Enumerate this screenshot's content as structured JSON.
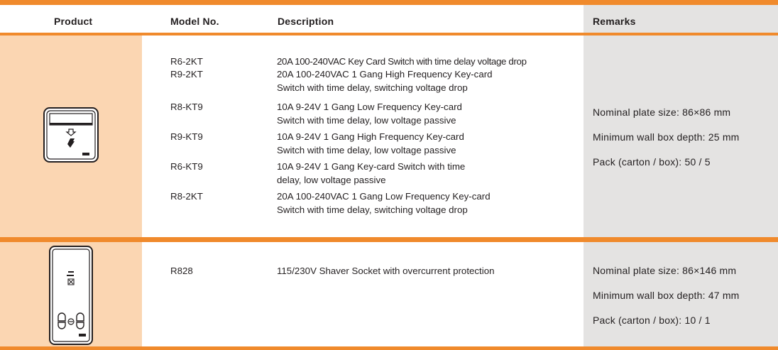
{
  "header": {
    "product": "Product",
    "model_no": "Model No.",
    "description": "Description",
    "remarks": "Remarks"
  },
  "rows": [
    {
      "product_icon": "key-card-switch-icon",
      "models": [
        {
          "model": "R6-2KT",
          "description": [
            "20A 100-240VAC Key Card Switch with time delay voltage drop"
          ]
        },
        {
          "model": "R9-2KT",
          "description": [
            "20A 100-240VAC 1 Gang High Frequency Key-card",
            "Switch with time delay, switching voltage drop"
          ]
        },
        {
          "model": "R8-KT9",
          "description": [
            "10A 9-24V 1 Gang Low Frequency Key-card",
            "Switch with time delay, low voltage passive"
          ]
        },
        {
          "model": "R9-KT9",
          "description": [
            "10A 9-24V 1 Gang High Frequency Key-card",
            "Switch with time delay, low voltage passive"
          ]
        },
        {
          "model": "R6-KT9",
          "description": [
            "10A 9-24V 1 Gang Key-card Switch with time",
            "delay, low voltage passive"
          ]
        },
        {
          "model": "R8-2KT",
          "description": [
            "20A 100-240VAC 1 Gang Low Frequency Key-card",
            "Switch with time delay, switching voltage drop"
          ]
        }
      ],
      "remarks": [
        "Nominal plate size: 86×86 mm",
        "Minimum wall box depth: 25 mm",
        "Pack (carton / box): 50 / 5"
      ]
    },
    {
      "product_icon": "shaver-socket-icon",
      "models": [
        {
          "model": "R828",
          "description": [
            "115/230V Shaver Socket with overcurrent protection"
          ]
        }
      ],
      "remarks": [
        "Nominal plate size: 86×146 mm",
        "Minimum wall box depth: 47 mm",
        "Pack (carton / box): 10 / 1"
      ]
    }
  ],
  "colors": {
    "accent": "#f08a2c",
    "product_bg": "#fbd6b2",
    "remarks_bg": "#e4e3e2"
  }
}
